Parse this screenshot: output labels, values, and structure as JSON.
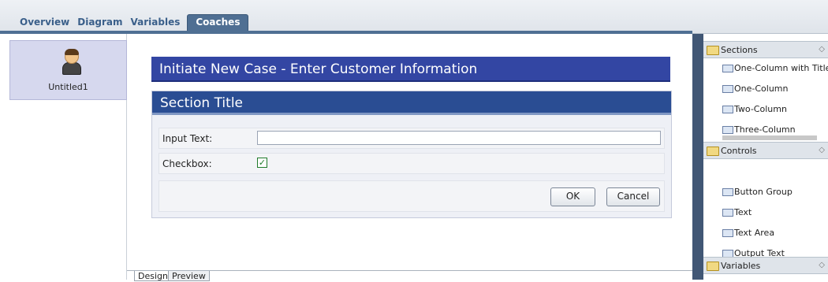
{
  "tabs": [
    "Overview",
    "Diagram",
    "Variables",
    "Coaches"
  ],
  "active_tab": "Coaches",
  "coaches": [
    {
      "label": "Untitled1"
    }
  ],
  "coach": {
    "title": "Initiate New Case -  Enter Customer Information",
    "section_title": "Section Title",
    "input_label": "Input Text:",
    "input_value": "",
    "checkbox_label": "Checkbox:",
    "checkbox_checked": true,
    "ok_label": "OK",
    "cancel_label": "Cancel"
  },
  "bottom_tabs": [
    "Design",
    "Preview"
  ],
  "palette": {
    "sections": {
      "label": "Sections",
      "items": [
        "One-Column with Title",
        "One-Column",
        "Two-Column",
        "Three-Column"
      ]
    },
    "controls": {
      "label": "Controls",
      "items": [
        "Button Group",
        "Text",
        "Text Area",
        "Output Text"
      ]
    },
    "variables": {
      "label": "Variables"
    }
  },
  "colors": {
    "title_bar": "#3346a3",
    "section_bar": "#2a4d93",
    "accent": "#4f6f93"
  }
}
